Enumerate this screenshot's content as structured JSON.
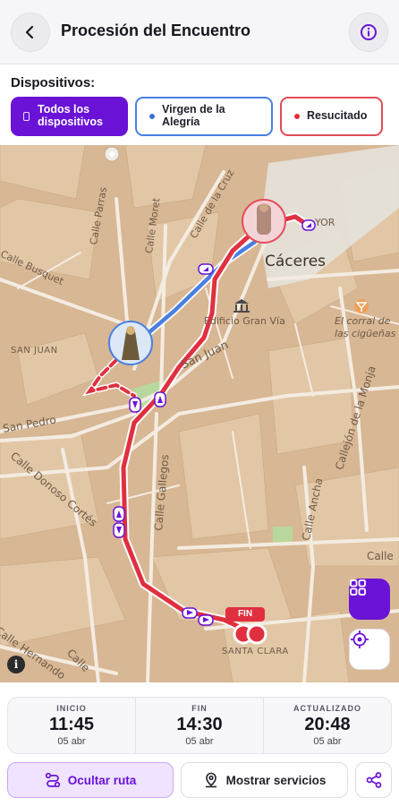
{
  "header": {
    "title": "Procesión del Encuentro"
  },
  "devices": {
    "label": "Dispositivos:",
    "items": [
      {
        "label": "Todos los dispositivos",
        "selected": true,
        "color": "#6a13d6"
      },
      {
        "label": "Virgen de la Alegría",
        "selected": false,
        "color": "#4a7fe2"
      },
      {
        "label": "Resucitado",
        "selected": false,
        "color": "#e24c58"
      }
    ]
  },
  "map": {
    "city": "Cáceres",
    "streets": [
      "Calle Parras",
      "Calle Moret",
      "Calle de la Cruz",
      "Calle Busquet",
      "San Juan",
      "San Pedro",
      "Calle Donoso Cortés",
      "Calle Gallegos",
      "Calle Ancha",
      "Callejón de la Monja",
      "Calle Hernando",
      "Calle",
      "YOR",
      "SAN JUAN",
      "SANTA CLARA",
      "Calle"
    ],
    "pois": [
      "Edificio Gran Vía",
      "El corral de las cigüeñas"
    ],
    "fin_tag": "FIN",
    "route_colors": {
      "virgen": "#4a7fe2",
      "resucitado": "#e0303f"
    },
    "icons": [
      "layers-grid-icon",
      "locate-icon",
      "map-info-icon"
    ]
  },
  "times": [
    {
      "label": "INICIO",
      "value": "11:45",
      "date": "05 abr"
    },
    {
      "label": "FIN",
      "value": "14:30",
      "date": "05 abr"
    },
    {
      "label": "ACTUALIZADO",
      "value": "20:48",
      "date": "05 abr"
    }
  ],
  "actions": {
    "hide_route": "Ocultar ruta",
    "show_services": "Mostrar servicios"
  }
}
